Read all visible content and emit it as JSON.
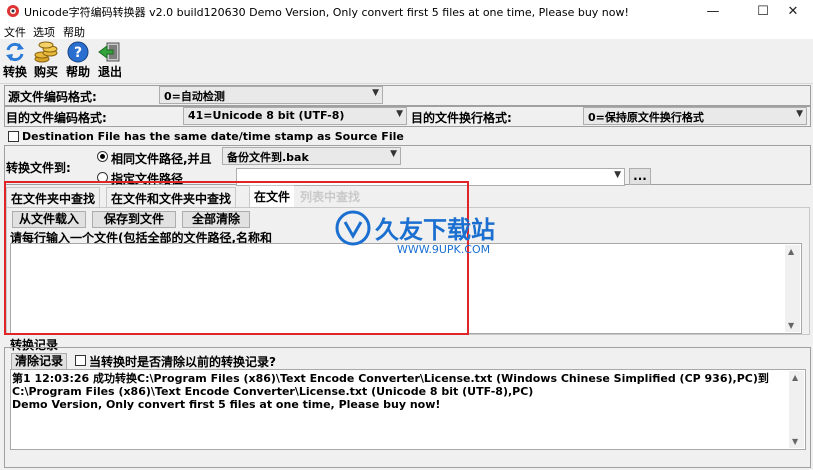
{
  "window": {
    "title": "Unicode字符编码转换器 v2.0 build120630 Demo Version, Only convert first 5 files at one time, Please buy now!",
    "minimize": "—",
    "maximize": "☐",
    "close": "✕"
  },
  "menu": [
    "文件",
    "选项",
    "帮助"
  ],
  "toolbar": [
    {
      "label": "转换",
      "icon": "refresh-icon"
    },
    {
      "label": "购买",
      "icon": "coins-icon"
    },
    {
      "label": "帮助",
      "icon": "help-icon"
    },
    {
      "label": "退出",
      "icon": "exit-icon"
    }
  ],
  "source": {
    "label": "源文件编码格式:",
    "value": "0=自动检测"
  },
  "target": {
    "label": "目的文件编码格式:",
    "value": "41=Unicode 8 bit (UTF-8)",
    "linebreak_label": "目的文件换行格式:",
    "linebreak_value": "0=保持原文件换行格式"
  },
  "timestamp_checkbox": "Destination File has the same date/time stamp as Source File",
  "convert_to": {
    "label": "转换文件到:",
    "option_same": "相同文件路径,并且",
    "backup_value": "备份文件到.bak",
    "option_custom": "指定文件路径",
    "path_value": "",
    "browse": "..."
  },
  "tabs": [
    "在文件夹中查找",
    "在文件和文件夹中查找",
    "在文件",
    "列表中查找"
  ],
  "file_tab": {
    "load_button": "从文件载入",
    "save_button": "保存到文件",
    "clear_button": "全部清除",
    "hint": "请每行输入一个文件(包括全部的文件路径,名称和"
  },
  "log": {
    "title": "转换记录",
    "clear_button": "清除记录",
    "clear_checkbox": "当转换时是否清除以前的转换记录?",
    "line1": "第1 12:03:26 成功转换C:\\Program Files (x86)\\Text Encode Converter\\License.txt (Windows Chinese Simplified (CP 936),PC)到C:\\Program Files (x86)\\Text Encode Converter\\License.txt (Unicode 8 bit (UTF-8),PC)",
    "line2": "Demo Version, Only convert first 5 files at one time, Please buy now!"
  },
  "watermark": {
    "brand": "久友下载站",
    "url": "WWW.9UPK.COM"
  },
  "colors": {
    "highlight_border": "#e0242a",
    "watermark": "#1a6fd0"
  }
}
